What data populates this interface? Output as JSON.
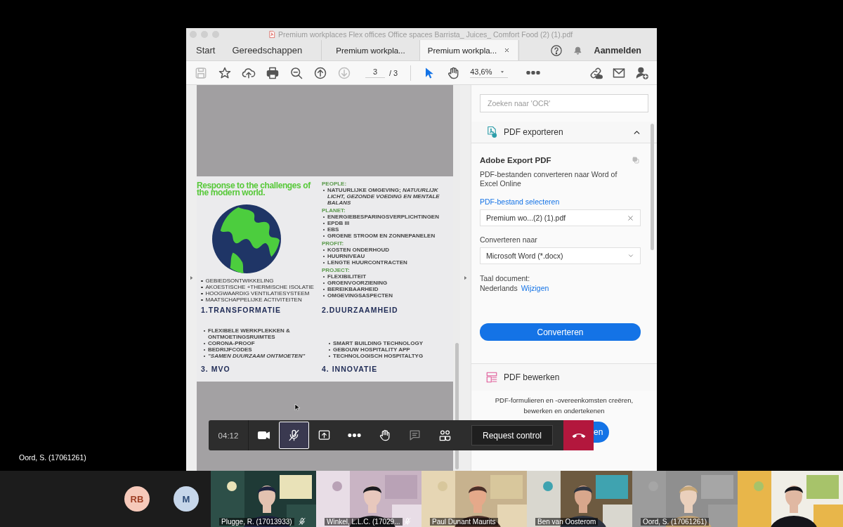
{
  "stage_label": "Oord, S. (17061261)",
  "window": {
    "title": "Premium workplaces Flex offices Office spaces Barrista_ Juices_ Comfort Food (2) (1).pdf"
  },
  "menu": [
    {
      "label": "Start"
    },
    {
      "label": "Gereedschappen"
    }
  ],
  "tabs": [
    {
      "label": "Premium workpla...",
      "selected": false
    },
    {
      "label": "Premium workpla...",
      "selected": true
    }
  ],
  "signin": "Aanmelden",
  "toolbar": {
    "left_tools": [
      {
        "kind": "save",
        "disabled": true
      },
      {
        "kind": "star",
        "disabled": false
      },
      {
        "kind": "upload",
        "disabled": false
      },
      {
        "kind": "print",
        "disabled": false
      },
      {
        "kind": "zoom-out",
        "disabled": false
      },
      {
        "kind": "page-up",
        "disabled": false
      },
      {
        "kind": "page-down",
        "disabled": true
      }
    ],
    "page": "3",
    "page_count": "/ 3",
    "mode_tools": [
      {
        "kind": "pointer",
        "selected": true
      },
      {
        "kind": "hand",
        "selected": false
      }
    ],
    "zoom": "43,6%",
    "right_tools": [
      {
        "kind": "share-link"
      },
      {
        "kind": "mail"
      },
      {
        "kind": "add-user"
      }
    ]
  },
  "document": {
    "title": "Response to the challenges of the modern world.",
    "quadrants": [
      {
        "heading": "1.TRANSFORMATIE",
        "items": [
          {
            "text": "GEBIEDSONTWIKKELING",
            "kind": "plain"
          },
          {
            "text": "AKOESTISCHE +THERMISCHE ISOLATIE",
            "kind": "plain"
          },
          {
            "text": "HOOGWAARDIG VENTILATIESYSTEEM",
            "kind": "plain"
          },
          {
            "text": "MAATSCHAPPELIJKE ACTIVITEITEN",
            "kind": "plain"
          }
        ]
      },
      {
        "heading": "2.DUURZAAMHEID",
        "sections": [
          {
            "label": "PEOPLE:",
            "items": [
              {
                "text": "NATUURLIJKE OMGEVING; *NATUURLIJK LICHT, GEZONDE VOEDING EN MENTALE BALANS*",
                "kind": "plain"
              }
            ]
          },
          {
            "label": "PLANET:",
            "items": [
              {
                "text": "ENERGIEBESPARINGSVERPLICHTINGEN",
                "kind": "plain"
              },
              {
                "text": "EPDB III",
                "kind": "plain"
              },
              {
                "text": "EBS",
                "kind": "plain"
              },
              {
                "text": "GROENE STROOM EN ZONNEPANELEN",
                "kind": "plain"
              }
            ]
          },
          {
            "label": "PROFIT:",
            "items": [
              {
                "text": "KOSTEN ONDERHOUD",
                "kind": "plain"
              },
              {
                "text": "HUURNIVEAU",
                "kind": "plain"
              },
              {
                "text": "LENGTE HUURCONTRACTEN",
                "kind": "plain"
              }
            ]
          },
          {
            "label": "PROJECT:",
            "items": [
              {
                "text": "FLEXIBILITEIT",
                "kind": "plain"
              },
              {
                "text": "GROENVOORZIENING",
                "kind": "plain"
              },
              {
                "text": "BEREIKBAARHEID",
                "kind": "plain"
              },
              {
                "text": "OMGEVINGSASPECTEN",
                "kind": "plain"
              }
            ]
          }
        ]
      },
      {
        "heading": "3. MVO",
        "items": [
          {
            "text": "FLEXIBELE WERKPLEKKEN & ONTMOETINGSRUIMTES",
            "kind": "plain"
          },
          {
            "text": "CORONA-PROOF",
            "kind": "plain"
          },
          {
            "text": "BEDRIJFCODES",
            "kind": "plain"
          },
          {
            "text": "\"SAMEN DUURZAAM ONTMOETEN\"",
            "kind": "quote"
          }
        ]
      },
      {
        "heading": "4. INNOVATIE",
        "items": [
          {
            "text": "SMART BUILDING TECHNOLOGY",
            "kind": "plain"
          },
          {
            "text": "GEBOUW HOSPITALITY APP",
            "kind": "plain"
          },
          {
            "text": "TECHNOLOGISCH HOSPITALTYG",
            "kind": "plain"
          }
        ]
      }
    ]
  },
  "panel": {
    "search": {
      "placeholder": "Zoeken naar 'OCR'"
    },
    "export": {
      "title": "PDF exporteren",
      "expanded": true,
      "heading": "Adobe Export PDF",
      "description": "PDF-bestanden converteren naar Word of Excel Online",
      "select_link": "PDF-bestand selecteren",
      "file": "Premium wo...(2) (1).pdf",
      "convert_label": "Converteren naar",
      "format": "Microsoft Word (*.docx)",
      "language_label": "Taal document:",
      "language": "Nederlands",
      "change_link": "Wijzigen",
      "button": "Converteren"
    },
    "edit": {
      "title": "PDF bewerken",
      "description": "PDF-formulieren en -overeenkomsten creëren, bewerken en ondertekenen",
      "button": "en"
    }
  },
  "call_bar": {
    "timer": "04:12",
    "controls": [
      {
        "kind": "camera",
        "selected": false,
        "disabled": false
      },
      {
        "kind": "mic-off",
        "selected": true,
        "disabled": false
      },
      {
        "kind": "share-screen",
        "selected": false,
        "disabled": false
      },
      {
        "kind": "more",
        "selected": false,
        "disabled": false
      },
      {
        "kind": "hand",
        "selected": false,
        "disabled": false
      },
      {
        "kind": "chat",
        "selected": false,
        "disabled": true
      },
      {
        "kind": "people",
        "selected": false,
        "disabled": false
      }
    ],
    "request": "Request control"
  },
  "avatars": [
    {
      "initials": "RB",
      "color": "#f6c9ba"
    },
    {
      "initials": "M",
      "color": "#c6d6ea"
    }
  ],
  "videos": [
    {
      "name": "Plugge, R. (17013933)",
      "muted": true
    },
    {
      "name": "Winkel, L.L.C. (17029...",
      "muted": true
    },
    {
      "name": "Paul Dunant Maurits",
      "muted": false
    },
    {
      "name": "Ben van Oosterom",
      "muted": false
    },
    {
      "name": "Oord, S. (17061261)",
      "muted": false
    },
    {
      "muted": false
    }
  ]
}
